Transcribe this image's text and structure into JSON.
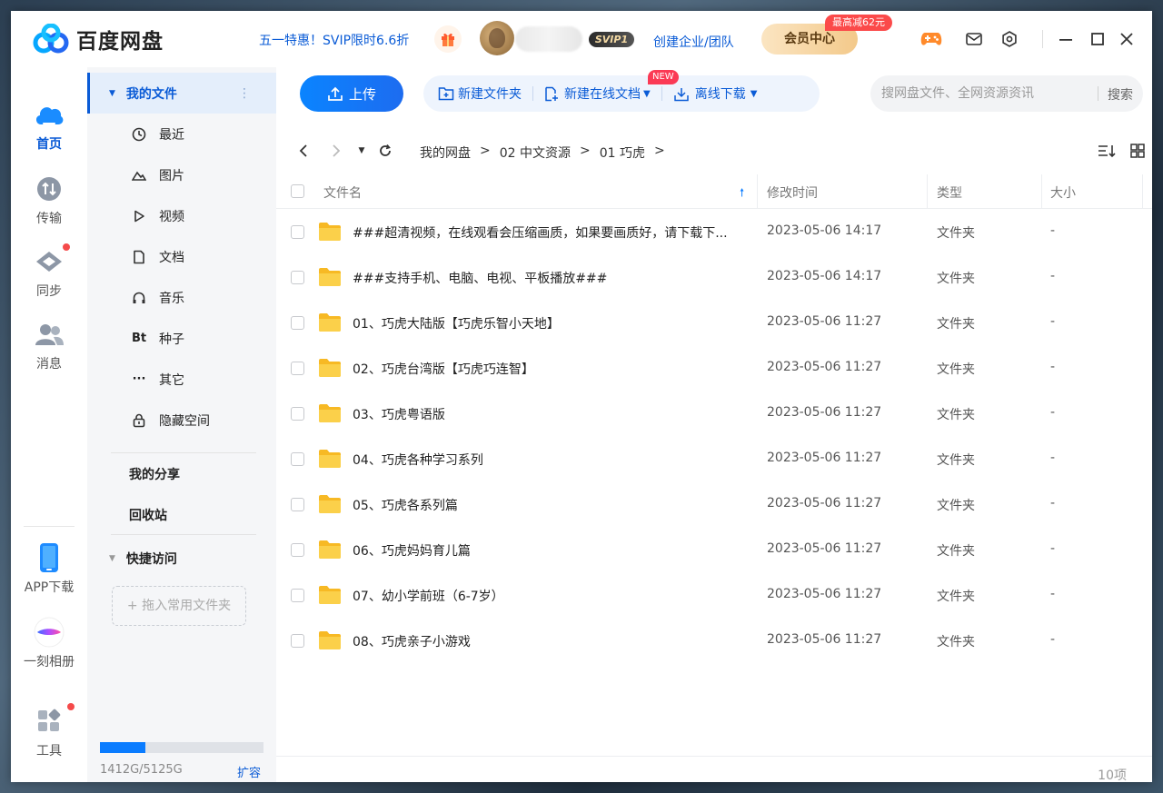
{
  "app": {
    "name": "百度网盘"
  },
  "header": {
    "promo": "五一特惠！SVIP限时6.6折",
    "svip_badge": "SVIP1",
    "create_team": "创建企业/团队",
    "vip_center": "会员中心",
    "vip_discount": "最高减62元",
    "icons": [
      "game-icon",
      "mail-icon",
      "settings-icon",
      "minimize-icon",
      "maximize-icon",
      "close-icon"
    ]
  },
  "rail": {
    "items": [
      {
        "label": "首页",
        "icon": "home-cloud-icon",
        "active": true
      },
      {
        "label": "传输",
        "icon": "transfer-icon"
      },
      {
        "label": "同步",
        "icon": "sync-icon"
      },
      {
        "label": "消息",
        "icon": "message-icon"
      },
      {
        "label": "APP下载",
        "icon": "phone-icon"
      },
      {
        "label": "一刻相册",
        "icon": "album-icon"
      },
      {
        "label": "工具",
        "icon": "tools-icon"
      }
    ]
  },
  "sidenav": {
    "my_files": "我的文件",
    "items": [
      {
        "label": "最近",
        "icon": "clock-icon"
      },
      {
        "label": "图片",
        "icon": "image-icon"
      },
      {
        "label": "视频",
        "icon": "video-icon"
      },
      {
        "label": "文档",
        "icon": "document-icon"
      },
      {
        "label": "音乐",
        "icon": "headphone-icon"
      },
      {
        "label": "种子",
        "icon": "bt-icon",
        "glyph": "Bt"
      },
      {
        "label": "其它",
        "icon": "more-icon",
        "glyph": "···"
      },
      {
        "label": "隐藏空间",
        "icon": "lock-icon"
      }
    ],
    "my_share": "我的分享",
    "recycle": "回收站",
    "quick_access": "快捷访问",
    "quick_drop": "+ 拖入常用文件夹",
    "quota": {
      "used_text": "1412G/5125G",
      "used_fraction": 0.2755,
      "expand": "扩容"
    }
  },
  "toolbar": {
    "upload": "上传",
    "new_folder": "新建文件夹",
    "new_online_doc": "新建在线文档",
    "new_badge": "NEW",
    "offline_download": "离线下载",
    "search_placeholder": "搜网盘文件、全网资源资讯",
    "search_button": "搜索"
  },
  "breadcrumb": [
    "我的网盘",
    "02 中文资源",
    "01 巧虎"
  ],
  "table": {
    "columns": {
      "name": "文件名",
      "modified": "修改时间",
      "type": "类型",
      "size": "大小"
    },
    "rows": [
      {
        "name": "###超清视频，在线观看会压缩画质，如果要画质好，请下载下...",
        "modified": "2023-05-06 14:17",
        "type": "文件夹",
        "size": "-"
      },
      {
        "name": "###支持手机、电脑、电视、平板播放###",
        "modified": "2023-05-06 14:17",
        "type": "文件夹",
        "size": "-"
      },
      {
        "name": "01、巧虎大陆版【巧虎乐智小天地】",
        "modified": "2023-05-06 11:27",
        "type": "文件夹",
        "size": "-"
      },
      {
        "name": "02、巧虎台湾版【巧虎巧连智】",
        "modified": "2023-05-06 11:27",
        "type": "文件夹",
        "size": "-"
      },
      {
        "name": "03、巧虎粤语版",
        "modified": "2023-05-06 11:27",
        "type": "文件夹",
        "size": "-"
      },
      {
        "name": "04、巧虎各种学习系列",
        "modified": "2023-05-06 11:27",
        "type": "文件夹",
        "size": "-"
      },
      {
        "name": "05、巧虎各系列篇",
        "modified": "2023-05-06 11:27",
        "type": "文件夹",
        "size": "-"
      },
      {
        "name": "06、巧虎妈妈育儿篇",
        "modified": "2023-05-06 11:27",
        "type": "文件夹",
        "size": "-"
      },
      {
        "name": "07、幼小学前班（6-7岁）",
        "modified": "2023-05-06 11:27",
        "type": "文件夹",
        "size": "-"
      },
      {
        "name": "08、巧虎亲子小游戏",
        "modified": "2023-05-06 11:27",
        "type": "文件夹",
        "size": "-"
      }
    ]
  },
  "footer": {
    "count": "10项"
  },
  "colors": {
    "accent": "#0a5bd6",
    "upload_gradient_start": "#0a84ff",
    "folder": "#f9c437",
    "red_dot": "#f54a4a"
  }
}
